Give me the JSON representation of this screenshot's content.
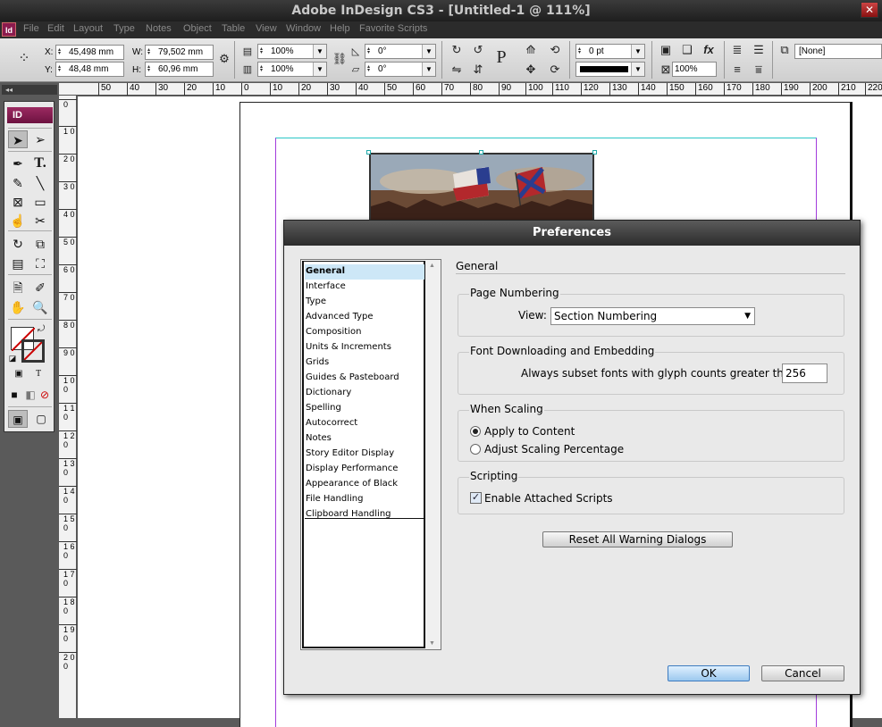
{
  "window": {
    "title": "Adobe InDesign CS3 - [Untitled-1 @ 111%]",
    "app_icon": "Id",
    "close_glyph": "✕"
  },
  "menu": [
    "File",
    "Edit",
    "Layout",
    "Type",
    "Notes",
    "Object",
    "Table",
    "View",
    "Window",
    "Help",
    "Favorite Scripts"
  ],
  "control_panel": {
    "x_label": "X:",
    "x_value": "45,498 mm",
    "y_label": "Y:",
    "y_value": "48,48 mm",
    "w_label": "W:",
    "w_value": "79,502 mm",
    "h_label": "H:",
    "h_value": "60,96 mm",
    "scale_x": "100%",
    "scale_y": "100%",
    "rotate": "0°",
    "shear": "0°",
    "stroke_weight": "0 pt",
    "opacity": "100%",
    "object_style": "[None]",
    "text_frame_glyph": "P"
  },
  "tools_panel": {
    "logo": "ID",
    "collapse": "◂◂"
  },
  "rulers": {
    "horizontal": [
      "50",
      "40",
      "30",
      "20",
      "10",
      "0",
      "10",
      "20",
      "30",
      "40",
      "50",
      "60",
      "70",
      "80",
      "90",
      "100",
      "110",
      "120",
      "130",
      "140",
      "150",
      "160",
      "170",
      "180",
      "190",
      "200",
      "210",
      "220"
    ],
    "vertical": [
      "0",
      "1 0",
      "2 0",
      "3 0",
      "4 0",
      "5 0",
      "6 0",
      "7 0",
      "8 0",
      "9 0",
      "1 0 0",
      "1 1 0",
      "1 2 0",
      "1 3 0",
      "1 4 0",
      "1 5 0",
      "1 6 0",
      "1 7 0",
      "1 8 0",
      "1 9 0",
      "2 0 0"
    ]
  },
  "preferences": {
    "title": "Preferences",
    "categories": [
      "General",
      "Interface",
      "Type",
      "Advanced Type",
      "Composition",
      "Units & Increments",
      "Grids",
      "Guides & Pasteboard",
      "Dictionary",
      "Spelling",
      "Autocorrect",
      "Notes",
      "Story Editor Display",
      "Display Performance",
      "Appearance of Black",
      "File Handling",
      "Clipboard Handling"
    ],
    "selected_category": "General",
    "panel_title": "General",
    "page_numbering": {
      "title": "Page Numbering",
      "view_label": "View:",
      "view_value": "Section Numbering"
    },
    "font_downloading": {
      "title": "Font Downloading and Embedding",
      "subset_label": "Always subset fonts with glyph counts greater than:",
      "subset_value": "256"
    },
    "when_scaling": {
      "title": "When Scaling",
      "apply_to_content": "Apply to Content",
      "adjust_scaling": "Adjust Scaling Percentage",
      "selected": "Apply to Content"
    },
    "scripting": {
      "title": "Scripting",
      "enable_label": "Enable Attached Scripts",
      "enabled": true
    },
    "reset_button": "Reset All Warning Dialogs",
    "ok_button": "OK",
    "cancel_button": "Cancel"
  }
}
